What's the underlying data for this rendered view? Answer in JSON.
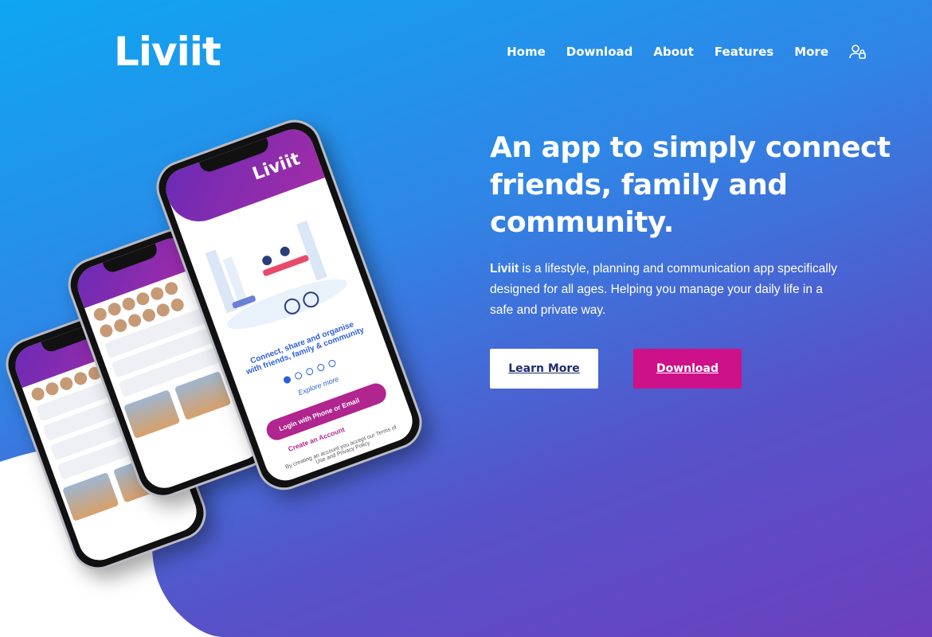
{
  "brand": {
    "name": "Liviit"
  },
  "nav": {
    "items": [
      {
        "label": "Home"
      },
      {
        "label": "Download"
      },
      {
        "label": "About"
      },
      {
        "label": "Features"
      },
      {
        "label": "More"
      }
    ],
    "account_icon": "user-lock-icon"
  },
  "hero": {
    "headline": "An app to simply connect friends, family and community.",
    "brand_word": "Liviit",
    "description": " is a lifestyle, planning and communication app specifically designed for all ages. Helping you manage your daily life in a safe and private way."
  },
  "buttons": {
    "learn_more": "Learn More",
    "download": "Download"
  },
  "phone_main": {
    "brand": "Liviit",
    "tagline": "Connect, share and organise with friends, family & community",
    "explore": "Explore more",
    "login": "Login with Phone or Email",
    "create": "Create an Account",
    "terms": "By creating an account you accept our Terms of Use and Privacy Policy"
  },
  "colors": {
    "accent": "#cc1189",
    "gradient_top": "#0fa6f2",
    "gradient_bottom": "#6d3fbe"
  }
}
